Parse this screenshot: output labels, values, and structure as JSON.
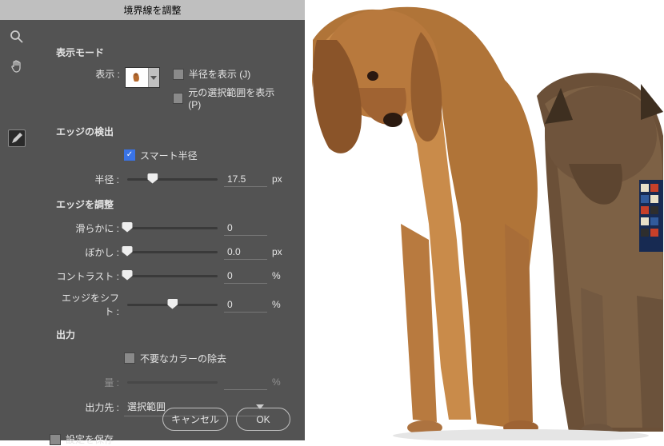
{
  "title": "境界線を調整",
  "sections": {
    "viewMode": {
      "title": "表示モード",
      "viewLabel": "表示 :",
      "showRadius": "半径を表示 (J)",
      "showOriginal": "元の選択範囲を表示 (P)"
    },
    "edgeDetect": {
      "title": "エッジの検出",
      "smartRadius": "スマート半径",
      "radiusLabel": "半径 :",
      "radiusValue": "17.5",
      "radiusUnit": "px"
    },
    "edgeAdjust": {
      "title": "エッジを調整",
      "smooth": {
        "label": "滑らかに :",
        "value": "0"
      },
      "feather": {
        "label": "ぼかし :",
        "value": "0.0",
        "unit": "px"
      },
      "contrast": {
        "label": "コントラスト :",
        "value": "0",
        "unit": "%"
      },
      "shift": {
        "label": "エッジをシフト :",
        "value": "0",
        "unit": "%"
      }
    },
    "output": {
      "title": "出力",
      "decontaminate": "不要なカラーの除去",
      "amountLabel": "量 :",
      "amountUnit": "%",
      "destLabel": "出力先 :",
      "destValue": "選択範囲"
    }
  },
  "saveSettings": "設定を保存",
  "buttons": {
    "cancel": "キャンセル",
    "ok": "OK"
  }
}
